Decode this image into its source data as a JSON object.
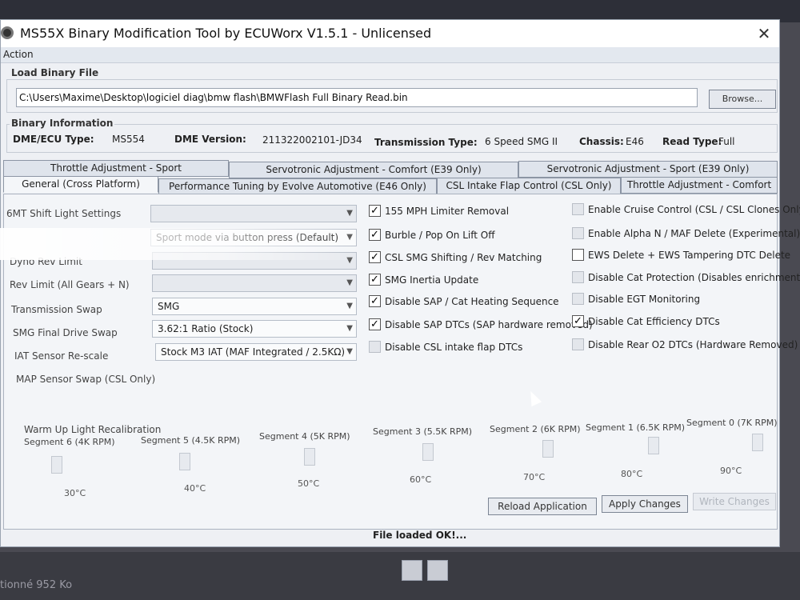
{
  "window": {
    "title": "MS55X Binary Modification Tool by ECUWorx V1.5.1 - Unlicensed",
    "close_glyph": "✕"
  },
  "menu": {
    "action": "Action"
  },
  "load_binary": {
    "group_label": "Load Binary File",
    "path": "C:\\Users\\Maxime\\Desktop\\logiciel diag\\bmw flash\\BMWFlash Full Binary Read.bin",
    "browse_label": "Browse..."
  },
  "binary_info": {
    "group_label": "Binary Information",
    "dme_ecu_type_label": "DME/ECU Type:",
    "dme_ecu_type_value": "MS554",
    "dme_version_label": "DME Version:",
    "dme_version_value": "211322002101-JD34",
    "transmission_type_label": "Transmission Type:",
    "transmission_type_value": "6 Speed SMG II",
    "chassis_label": "Chassis:",
    "chassis_value": "E46",
    "read_type_label": "Read Type:",
    "read_type_value": "Full"
  },
  "tabs_row1": [
    {
      "label": "Throttle Adjustment - Sport"
    },
    {
      "label": "Servotronic Adjustment - Comfort (E39 Only)"
    },
    {
      "label": "Servotronic Adjustment - Sport (E39 Only)"
    }
  ],
  "tabs_row2": [
    {
      "label": "General (Cross Platform)"
    },
    {
      "label": "Performance Tuning by Evolve Automotive (E46 Only)"
    },
    {
      "label": "CSL Intake Flap Control (CSL Only)"
    },
    {
      "label": "Throttle Adjustment - Comfort"
    }
  ],
  "settings": {
    "shift_light_label": "6MT Shift Light Settings",
    "sport_mode_value": "Sport mode via button press (Default)",
    "dyno_rev_limit_label": "Dyno Rev Limit",
    "rev_limit_label": "Rev Limit (All Gears + N)",
    "transmission_swap_label": "Transmission Swap",
    "transmission_swap_value": "SMG",
    "smg_final_drive_label": "SMG Final Drive Swap",
    "smg_final_drive_value": "3.62:1 Ratio (Stock)",
    "iat_rescale_label": "IAT Sensor Re-scale",
    "iat_rescale_value": "Stock M3 IAT (MAF Integrated / 2.5KΩ)",
    "map_sensor_label": "MAP Sensor Swap (CSL Only)"
  },
  "checks_mid": [
    {
      "label": "155 MPH Limiter Removal",
      "mark": "✓"
    },
    {
      "label": "Burble / Pop On Lift Off",
      "mark": "✓"
    },
    {
      "label": "CSL SMG Shifting / Rev Matching",
      "mark": "✓"
    },
    {
      "label": "SMG Inertia Update",
      "mark": "✓"
    },
    {
      "label": "Disable SAP / Cat Heating Sequence",
      "mark": "✓"
    },
    {
      "label": "Disable SAP DTCs (SAP hardware removed)",
      "mark": "✓"
    },
    {
      "label": "Disable CSL intake flap DTCs",
      "mark": ""
    }
  ],
  "checks_right": [
    {
      "label": "Enable Cruise Control (CSL / CSL Clones Only)",
      "mark": ""
    },
    {
      "label": "Enable Alpha N / MAF Delete (Experimental)",
      "mark": ""
    },
    {
      "label": "EWS Delete + EWS Tampering DTC Delete",
      "mark": ""
    },
    {
      "label": "Disable Cat Protection (Disables enrichment)",
      "mark": ""
    },
    {
      "label": "Disable EGT Monitoring",
      "mark": ""
    },
    {
      "label": "Disable Cat Efficiency DTCs",
      "mark": "✓"
    },
    {
      "label": "Disable Rear O2 DTCs (Hardware Removed)",
      "mark": ""
    }
  ],
  "warmup": {
    "title": "Warm Up Light Recalibration",
    "segments": [
      "Segment 6 (4K RPM)",
      "Segment 5 (4.5K RPM)",
      "Segment 4 (5K RPM)",
      "Segment 3 (5.5K RPM)",
      "Segment 2 (6K RPM)",
      "Segment 1 (6.5K RPM)",
      "Segment 0 (7K RPM)"
    ],
    "temps": [
      "30°C",
      "40°C",
      "50°C",
      "60°C",
      "70°C",
      "80°C",
      "90°C"
    ]
  },
  "buttons": {
    "reload": "Reload Application",
    "apply": "Apply Changes",
    "write": "Write Changes"
  },
  "status": {
    "message": "File loaded OK!...",
    "bottom_left": "tionné 952 Ko"
  }
}
